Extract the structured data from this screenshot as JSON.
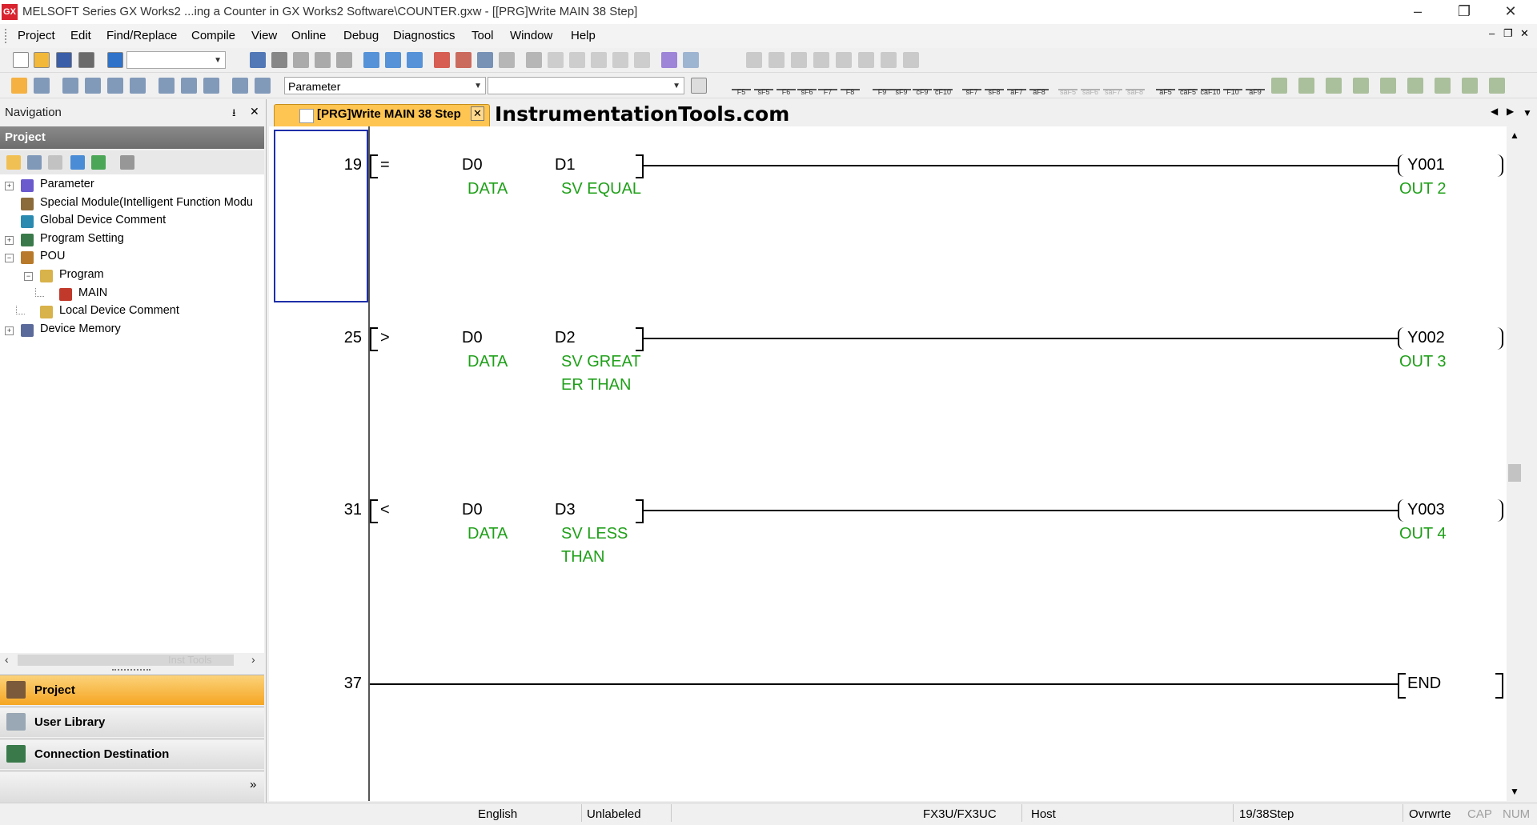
{
  "window": {
    "title": "MELSOFT Series GX Works2 ...ing a Counter in GX Works2 Software\\COUNTER.gxw - [[PRG]Write MAIN 38 Step]",
    "app_icon_text": "GX",
    "minimize": "–",
    "maximize": "❐",
    "close": "✕"
  },
  "menu": {
    "items": [
      "Project",
      "Edit",
      "Find/Replace",
      "Compile",
      "View",
      "Online",
      "Debug",
      "Diagnostics",
      "Tool",
      "Window",
      "Help"
    ],
    "mdi_controls": [
      "–",
      "❐",
      "✕"
    ]
  },
  "toolbar": {
    "parameter_combo": "Parameter",
    "fkeys": [
      "F5",
      "sF5",
      "F6",
      "sF6",
      "F7",
      "F8",
      "F9",
      "sF9",
      "cF9",
      "cF10",
      "sF7",
      "sF8",
      "aF7",
      "aF8",
      "saF5",
      "saF6",
      "saF7",
      "saF8",
      "aF5",
      "caF5",
      "caF10",
      "F10",
      "aF9"
    ]
  },
  "navigation": {
    "title": "Navigation",
    "pin": "⭳",
    "close": "✕",
    "project_header": "Project",
    "tree": [
      {
        "label": "Parameter",
        "level": 0,
        "expander": "+"
      },
      {
        "label": "Special Module(Intelligent Function Modu",
        "level": 0,
        "expander": ""
      },
      {
        "label": "Global Device Comment",
        "level": 0,
        "expander": ""
      },
      {
        "label": "Program Setting",
        "level": 0,
        "expander": "+"
      },
      {
        "label": "POU",
        "level": 0,
        "expander": "−"
      },
      {
        "label": "Program",
        "level": 1,
        "expander": "−"
      },
      {
        "label": "MAIN",
        "level": 2,
        "expander": ""
      },
      {
        "label": "Local Device Comment",
        "level": 1,
        "expander": ""
      },
      {
        "label": "Device Memory",
        "level": 0,
        "expander": "+"
      }
    ],
    "scroll_watermark": "Inst Tools",
    "tabs": [
      "Project",
      "User Library",
      "Connection Destination"
    ],
    "more": "»"
  },
  "editor": {
    "tab_label": "[PRG]Write MAIN 38 Step",
    "tab_close": "✕",
    "watermark": "InstrumentationTools.com",
    "rungs": [
      {
        "step": "19",
        "op": "=",
        "s1": "D0",
        "s2": "D1",
        "c1": [
          "DATA"
        ],
        "c2": [
          "SV EQUAL"
        ],
        "coil": "Y001",
        "coil_comment": "OUT 2"
      },
      {
        "step": "25",
        "op": ">",
        "s1": "D0",
        "s2": "D2",
        "c1": [
          "DATA"
        ],
        "c2": [
          "SV GREAT",
          "ER THAN"
        ],
        "coil": "Y002",
        "coil_comment": "OUT 3"
      },
      {
        "step": "31",
        "op": "<",
        "s1": "D0",
        "s2": "D3",
        "c1": [
          "DATA"
        ],
        "c2": [
          "SV LESS",
          "THAN"
        ],
        "coil": "Y003",
        "coil_comment": "OUT 4"
      }
    ],
    "end_step": "37",
    "end_label": "END"
  },
  "statusbar": {
    "language": "English",
    "label_state": "Unlabeled",
    "cpu": "FX3U/FX3UC",
    "connection": "Host",
    "step": "19/38Step",
    "mode": "Ovrwrte",
    "cap": "CAP",
    "num": "NUM"
  },
  "colors": {
    "comment": "#1fa019",
    "active_tab": "#ffc552",
    "cursor": "#1e2fa8",
    "selected_nav": "#f6a623"
  }
}
